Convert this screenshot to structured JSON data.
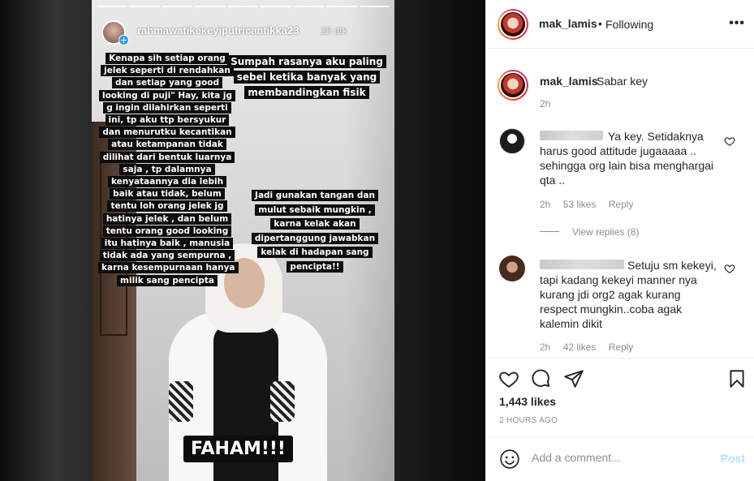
{
  "story": {
    "username": "rahmawatikekeyiputricantikka23",
    "time": "26 dtk",
    "text_left": "Kenapa sih setiap orang jelek seperti di rendahkan dan setiap yang good looking di puji\" Hay, kita jg g ingin dilahirkan seperti ini, tp aku ttp bersyukur dan menurutku kecantikan atau ketampanan tidak dilihat dari bentuk luarnya saja , tp dalamnya kenyataannya dia lebih baik atau tidak, belum tentu loh orang jelek jg hatinya jelek , dan belum tentu orang good looking itu hatinya baik , manusia tidak ada yang sempurna , karna kesempurnaan hanya milik sang pencipta",
    "text_top_right": "Sumpah rasanya aku paling sebel ketika banyak yang membandingkan fisik",
    "text_mid_right": "Jadi gunakan tangan dan mulut sebaik mungkin , karna kelak akan dipertanggung jawabkan kelak di hadapan sang pencipta!!",
    "text_bottom": "FAHAM!!!"
  },
  "header": {
    "username": "mak_lamis",
    "separator": "•",
    "follow_status": "Following",
    "more": "•••"
  },
  "caption": {
    "username": "mak_lamis",
    "text": "Sabar key",
    "time": "2h"
  },
  "comments": [
    {
      "text": "Ya key. Setidaknya harus good attitude jugaaaaa .. sehingga org lain bisa menghargai qta ..",
      "time": "2h",
      "likes": "53 likes",
      "reply": "Reply",
      "view_replies": "View replies (8)"
    },
    {
      "text": "Setuju sm kekeyi, tapi kadang kekeyi manner nya kurang jdi org2 agak kurang respect mungkin..coba agak kalemin dikit",
      "time": "2h",
      "likes": "42 likes",
      "reply": "Reply"
    }
  ],
  "post": {
    "likes": "1,443 likes",
    "time_ago": "2 HOURS AGO"
  },
  "add_comment": {
    "placeholder": "Add a comment...",
    "post_label": "Post"
  }
}
